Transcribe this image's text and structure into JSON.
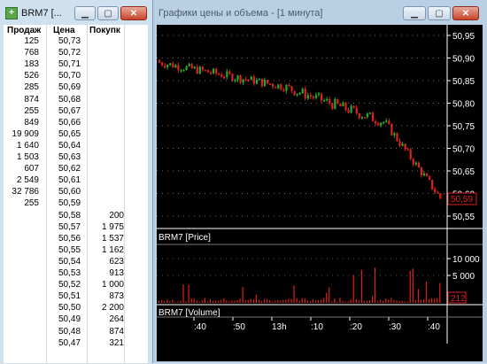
{
  "dom_window": {
    "title": "BRM7 [...",
    "headers": {
      "sell": "Продаж",
      "price": "Цена",
      "buy": "Покупк"
    },
    "rows": [
      {
        "sell": "125",
        "price": "50,73",
        "buy": ""
      },
      {
        "sell": "768",
        "price": "50,72",
        "buy": ""
      },
      {
        "sell": "183",
        "price": "50,71",
        "buy": ""
      },
      {
        "sell": "526",
        "price": "50,70",
        "buy": ""
      },
      {
        "sell": "285",
        "price": "50,69",
        "buy": ""
      },
      {
        "sell": "874",
        "price": "50,68",
        "buy": ""
      },
      {
        "sell": "255",
        "price": "50,67",
        "buy": ""
      },
      {
        "sell": "849",
        "price": "50,66",
        "buy": ""
      },
      {
        "sell": "19 909",
        "price": "50,65",
        "buy": ""
      },
      {
        "sell": "1 640",
        "price": "50,64",
        "buy": ""
      },
      {
        "sell": "1 503",
        "price": "50,63",
        "buy": ""
      },
      {
        "sell": "607",
        "price": "50,62",
        "buy": ""
      },
      {
        "sell": "2 549",
        "price": "50,61",
        "buy": ""
      },
      {
        "sell": "32 786",
        "price": "50,60",
        "buy": ""
      },
      {
        "sell": "255",
        "price": "50,59",
        "buy": ""
      },
      {
        "sell": "",
        "price": "50,58",
        "buy": "200"
      },
      {
        "sell": "",
        "price": "50,57",
        "buy": "1 975"
      },
      {
        "sell": "",
        "price": "50,56",
        "buy": "1 537"
      },
      {
        "sell": "",
        "price": "50,55",
        "buy": "1 162"
      },
      {
        "sell": "",
        "price": "50,54",
        "buy": "623"
      },
      {
        "sell": "",
        "price": "50,53",
        "buy": "913"
      },
      {
        "sell": "",
        "price": "50,52",
        "buy": "1 000"
      },
      {
        "sell": "",
        "price": "50,51",
        "buy": "873"
      },
      {
        "sell": "",
        "price": "50,50",
        "buy": "2 200"
      },
      {
        "sell": "",
        "price": "50,49",
        "buy": "264"
      },
      {
        "sell": "",
        "price": "50,48",
        "buy": "874"
      },
      {
        "sell": "",
        "price": "50,47",
        "buy": "321"
      }
    ]
  },
  "chart_window": {
    "title": "Графики цены и объема - [1 минута]",
    "price_panel_label": "BRM7 [Price]",
    "volume_panel_label": "BRM7 [Volume]",
    "price_ticks": [
      "50,95",
      "50,90",
      "50,85",
      "50,80",
      "50,75",
      "50,70",
      "50,65",
      "50,60",
      "50,55"
    ],
    "current_price": "50,59",
    "volume_ticks": [
      "10 000",
      "5 000"
    ],
    "current_volume": "212",
    "time_ticks": [
      ":40",
      ":50",
      "13h",
      ":10",
      ":20",
      ":30",
      ":40"
    ],
    "colors": {
      "up": "#1fae2a",
      "down": "#e0201c",
      "background": "#000000",
      "axis": "#ffffff"
    }
  }
}
